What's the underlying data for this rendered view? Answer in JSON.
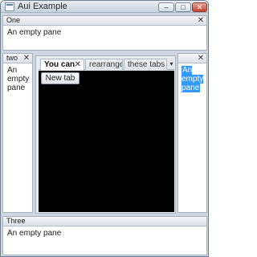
{
  "window": {
    "title": "Aui Example",
    "controls": {
      "minimize": "–",
      "maximize": "□",
      "close": "✕"
    }
  },
  "panes": {
    "one": {
      "caption": "One",
      "close": "✕",
      "text": "An empty pane"
    },
    "two": {
      "caption": "two",
      "close": "✕",
      "text": "An empty pane"
    },
    "right": {
      "close": "✕",
      "text": "An empty pane",
      "text_selected": true
    },
    "three": {
      "caption": "Three",
      "text": "An empty pane"
    }
  },
  "notebook": {
    "tabs": [
      {
        "label": "You can",
        "active": true,
        "close": "✕"
      },
      {
        "label": "rearrange",
        "active": false
      },
      {
        "label": "these tabs",
        "active": false
      }
    ],
    "tab_menu": "▾",
    "new_tab_button": "New tab"
  },
  "colors": {
    "selection": "#3399ff",
    "canvas": "#000000",
    "frame": "#cfd6df"
  }
}
